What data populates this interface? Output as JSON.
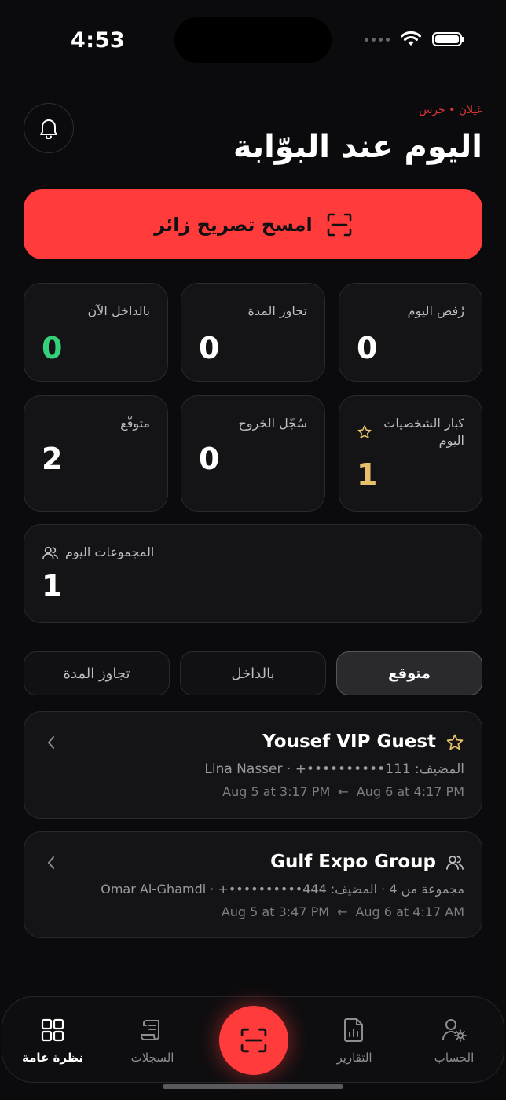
{
  "status": {
    "time": "4:53"
  },
  "header": {
    "brand": "غيلان • حرس",
    "title": "اليوم عند البوّابة"
  },
  "scan_cta": {
    "label": "امسح تصريح زائر"
  },
  "stats": [
    {
      "label": "رُفض اليوم",
      "value": "0"
    },
    {
      "label": "تجاوز المدة",
      "value": "0"
    },
    {
      "label": "بالداخل الآن",
      "value": "0"
    },
    {
      "label": "كبار الشخصيات اليوم",
      "value": "1"
    },
    {
      "label": "سُجّل الخروج",
      "value": "0"
    },
    {
      "label": "متوقّع",
      "value": "2"
    },
    {
      "label": "المجموعات اليوم",
      "value": "1"
    }
  ],
  "colors": {
    "accent": "#ff3b3b",
    "green": "#34d17a",
    "gold": "#e6c06a"
  },
  "tabs": [
    {
      "label": "متوقع"
    },
    {
      "label": "بالداخل"
    },
    {
      "label": "تجاوز المدة"
    }
  ],
  "visits": [
    {
      "title": "Yousef VIP Guest",
      "icon": "star-icon",
      "subtitle": "المضيف: Lina Nasser · +••••••••••111",
      "from": "Aug 5 at 3:17 PM",
      "to": "Aug 6 at 4:17 PM"
    },
    {
      "title": "Gulf Expo Group",
      "icon": "group-icon",
      "subtitle": "مجموعة من 4 · المضيف: Omar Al-Ghamdi · +••••••••••444",
      "from": "Aug 5 at 3:47 PM",
      "to": "Aug 6 at 4:17 AM"
    }
  ],
  "nav": {
    "overview": "نظرة عامة",
    "logs": "السجلات",
    "reports": "التقارير",
    "account": "الحساب"
  }
}
